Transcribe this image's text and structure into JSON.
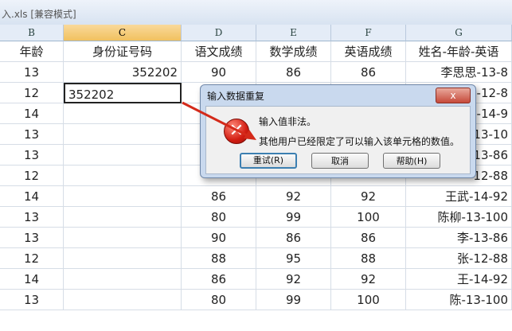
{
  "window": {
    "title": "入.xls  [兼容模式]"
  },
  "columns": [
    {
      "letter": "B",
      "header": "年龄"
    },
    {
      "letter": "C",
      "header": "身份证号码"
    },
    {
      "letter": "D",
      "header": "语文成绩"
    },
    {
      "letter": "E",
      "header": "数学成绩"
    },
    {
      "letter": "F",
      "header": "英语成绩"
    },
    {
      "letter": "G",
      "header": "姓名-年龄-英语"
    }
  ],
  "rows": [
    {
      "age": "13",
      "id": "352202",
      "chinese": "90",
      "math": "86",
      "english": "86",
      "combo": "李思思-13-8"
    },
    {
      "age": "12",
      "id": "",
      "chinese": "",
      "math": "",
      "english": "",
      "combo": "王-12-8"
    },
    {
      "age": "14",
      "id": "",
      "chinese": "",
      "math": "",
      "english": "",
      "combo": "武-14-9"
    },
    {
      "age": "13",
      "id": "",
      "chinese": "",
      "math": "",
      "english": "",
      "combo": "柳-13-10"
    },
    {
      "age": "13",
      "id": "",
      "chinese": "",
      "math": "",
      "english": "",
      "combo": "-13-86"
    },
    {
      "age": "12",
      "id": "",
      "chinese": "",
      "math": "",
      "english": "",
      "combo": "-12-88"
    },
    {
      "age": "14",
      "id": "",
      "chinese": "86",
      "math": "92",
      "english": "92",
      "combo": "王武-14-92"
    },
    {
      "age": "13",
      "id": "",
      "chinese": "80",
      "math": "99",
      "english": "100",
      "combo": "陈柳-13-100"
    },
    {
      "age": "13",
      "id": "",
      "chinese": "90",
      "math": "86",
      "english": "86",
      "combo": "李-13-86"
    },
    {
      "age": "12",
      "id": "",
      "chinese": "88",
      "math": "95",
      "english": "88",
      "combo": "张-12-88"
    },
    {
      "age": "14",
      "id": "",
      "chinese": "86",
      "math": "92",
      "english": "92",
      "combo": "王-14-92"
    },
    {
      "age": "13",
      "id": "",
      "chinese": "80",
      "math": "99",
      "english": "100",
      "combo": "陈-13-100"
    }
  ],
  "edit_value": "352202",
  "dialog": {
    "title": "输入数据重复",
    "close_label": "x",
    "icon": "error-icon",
    "message1": "输入值非法。",
    "message2": "其他用户已经限定了可以输入该单元格的数值。",
    "retry_label": "重试(R)",
    "cancel_label": "取消",
    "help_label": "帮助(H)"
  },
  "watermark": "Baidu 经验"
}
